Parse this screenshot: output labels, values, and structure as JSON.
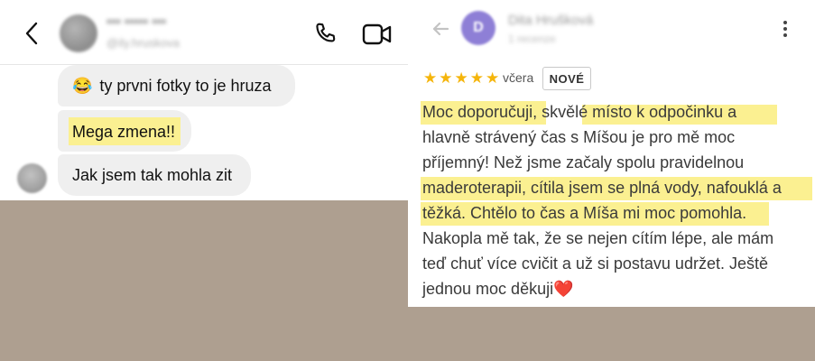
{
  "chat": {
    "messages": [
      {
        "emoji": "😂",
        "text": "ty prvni fotky to je hruza"
      },
      {
        "text": "Mega zmena!!"
      },
      {
        "text": "Jak jsem tak mohla zit"
      }
    ],
    "header": {
      "name": "••• ••••• •••",
      "subtitle": "@ily.hruskova"
    },
    "highlight_color": "#fbf091"
  },
  "review": {
    "reviewer": {
      "initial": "D",
      "name": "Dita Hrušková",
      "subtitle": "1 recenze"
    },
    "rating": 5,
    "date": "včera",
    "badge": "NOVÉ",
    "text_lines": [
      [
        "Moc doporučuji,",
        " skvělé místo k odpočinku a"
      ],
      [
        "hlavně strávený čas s Míšou je pro mě moc"
      ],
      [
        "příjemný! Než jsme začaly spolu pravidelnou"
      ],
      [
        "maderoterapii, cítila jsem se plná vody, nafouklá a"
      ],
      [
        "těžká. Chtělo to čas a Míša mi moc pomohla."
      ],
      [
        "Nakopla mě tak, že se nejen cítím lépe, ale mám"
      ],
      [
        "teď chuť více cvičit a už si postavu udržet. Ještě"
      ],
      [
        "jednou moc děkuji"
      ]
    ],
    "end_emoji": "❤️",
    "star_color": "#f5b50b"
  },
  "icons": {
    "chat_back": "chevron-left-icon",
    "chat_call": "phone-icon",
    "chat_video": "video-camera-icon",
    "review_back": "arrow-left-icon",
    "review_more": "more-vertical-icon"
  }
}
